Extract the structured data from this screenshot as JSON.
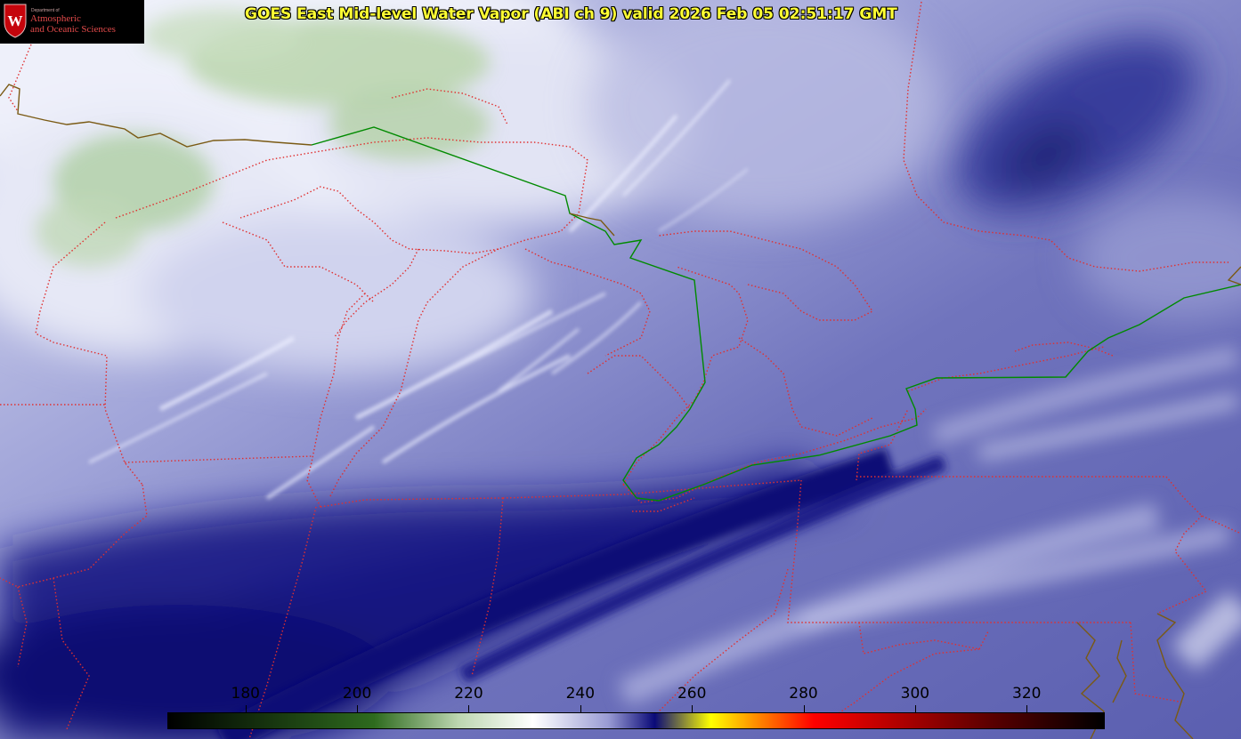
{
  "header": {
    "title": "GOES East Mid-level Water Vapor (ABI ch 9)  valid 2026 Feb 05 02:51:17 GMT"
  },
  "logo": {
    "department_small": "Department of",
    "line1": "Atmospheric",
    "line2": "and Oceanic Sciences",
    "emblem": "W"
  },
  "colorbar": {
    "ticks": [
      "180",
      "200",
      "220",
      "240",
      "260",
      "280",
      "300",
      "320"
    ],
    "tick_values": [
      180,
      200,
      220,
      240,
      260,
      280,
      300,
      320
    ],
    "range": [
      166,
      334
    ],
    "colors": {
      "black": "#000000",
      "green": "#2e6b1e",
      "light_green": "#bcd6b0",
      "white": "#ffffff",
      "lavender": "#9a9cd4",
      "navy": "#0a0a78",
      "yellow": "#ffff00",
      "orange": "#ff8800",
      "red": "#ff0000",
      "dark_red": "#5a0000"
    }
  },
  "map_colors": {
    "state_borders": "#e03030",
    "international_border": "#008a00",
    "coastline": "#7a5a14",
    "moist_band": "#0c0c7a",
    "cloud_white": "#eef0ff",
    "cold_top_green": "#b9d4ae"
  },
  "icons": {
    "logo": "uw-crest-icon"
  }
}
